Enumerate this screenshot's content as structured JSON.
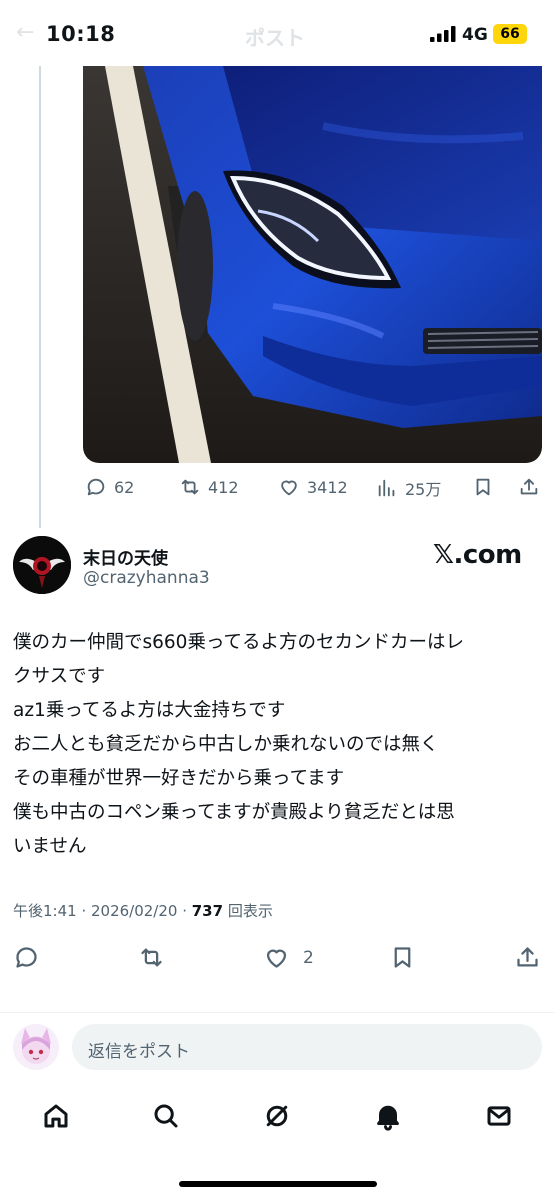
{
  "status_bar": {
    "time": "10:18",
    "network": "4G",
    "battery": "66"
  },
  "header": {
    "title": "ポスト"
  },
  "parent_post": {
    "replies": "62",
    "reposts": "412",
    "likes": "3412",
    "views": "25万"
  },
  "post": {
    "author_name": "末日の天使",
    "author_handle": "@crazyhanna3",
    "site_logo": "𝕏.com",
    "text_lines": [
      "僕のカー仲間でs660乗ってるよ方のセカンドカーはレ",
      "クサスです",
      "az1乗ってるよ方は大金持ちです",
      "お二人とも貧乏だから中古しか乗れないのでは無く",
      "その車種が世界一好きだから乗ってます",
      "僕も中古のコペン乗ってますが貴殿より貧乏だとは思",
      "いません"
    ],
    "timestamp": "午後1:41 · 2026/02/20 · ",
    "views_count": "737",
    "views_label": " 回表示",
    "likes": "2"
  },
  "reply_bar": {
    "placeholder": "返信をポスト"
  },
  "icons": [
    "reply-icon",
    "repost-icon",
    "like-icon",
    "views-icon",
    "bookmark-icon",
    "share-icon",
    "home-icon",
    "search-icon",
    "grok-icon",
    "notifications-icon",
    "messages-icon"
  ],
  "colors": {
    "accent_car": "#1f47c8",
    "text_secondary": "#536471",
    "battery": "#ffd60a"
  }
}
